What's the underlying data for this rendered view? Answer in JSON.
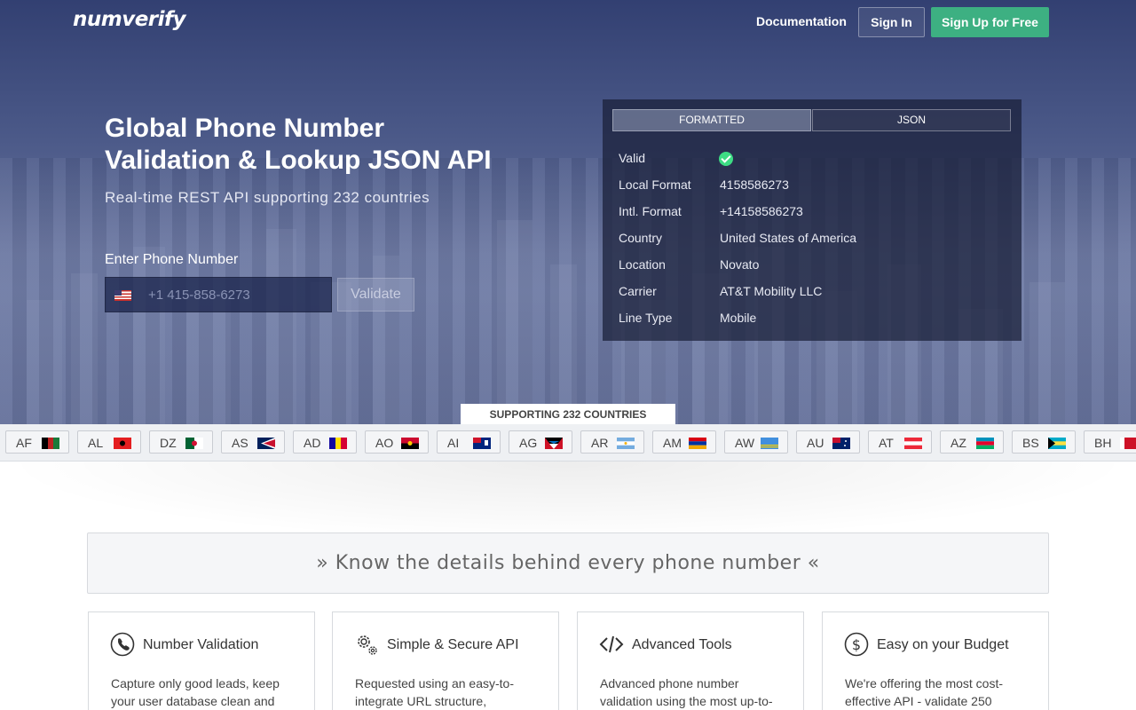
{
  "nav": {
    "logo": "numverify",
    "documentation": "Documentation",
    "sign_in": "Sign In",
    "sign_up": "Sign Up for Free"
  },
  "hero": {
    "title_line1": "Global Phone Number",
    "title_line2": "Validation & Lookup JSON API",
    "subtitle": "Real-time REST API supporting 232 countries",
    "input_label": "Enter Phone Number",
    "input_placeholder": "+1 415-858-6273",
    "validate_button": "Validate"
  },
  "result": {
    "tabs": {
      "formatted": "FORMATTED",
      "json": "JSON"
    },
    "rows": [
      {
        "key": "Valid",
        "value": ""
      },
      {
        "key": "Local Format",
        "value": "4158586273"
      },
      {
        "key": "Intl. Format",
        "value": "+14158586273"
      },
      {
        "key": "Country",
        "value": "United States of America"
      },
      {
        "key": "Location",
        "value": "Novato"
      },
      {
        "key": "Carrier",
        "value": "AT&T Mobility LLC"
      },
      {
        "key": "Line Type",
        "value": "Mobile"
      }
    ]
  },
  "countries": {
    "label": "SUPPORTING 232 COUNTRIES",
    "codes": [
      "AF",
      "AL",
      "DZ",
      "AS",
      "AD",
      "AO",
      "AI",
      "AG",
      "AR",
      "AM",
      "AW",
      "AU",
      "AT",
      "AZ",
      "BS",
      "BH"
    ]
  },
  "features": {
    "tagline": "» Know the details behind every phone number «",
    "cards": [
      {
        "icon": "phone-icon",
        "title": "Number Validation",
        "desc": "Capture only good leads, keep your user database clean and"
      },
      {
        "icon": "gears-icon",
        "title": "Simple & Secure API",
        "desc": "Requested using an easy-to-integrate URL structure,"
      },
      {
        "icon": "code-icon",
        "title": "Advanced Tools",
        "desc": "Advanced phone number validation using the most up-to-"
      },
      {
        "icon": "dollar-icon",
        "title": "Easy on your Budget",
        "desc": "We're offering the most cost-effective API - validate 250"
      }
    ]
  },
  "colors": {
    "hero_bg": "#2f3f76",
    "signup_green": "#3db082",
    "check_green": "#3ddc84"
  }
}
